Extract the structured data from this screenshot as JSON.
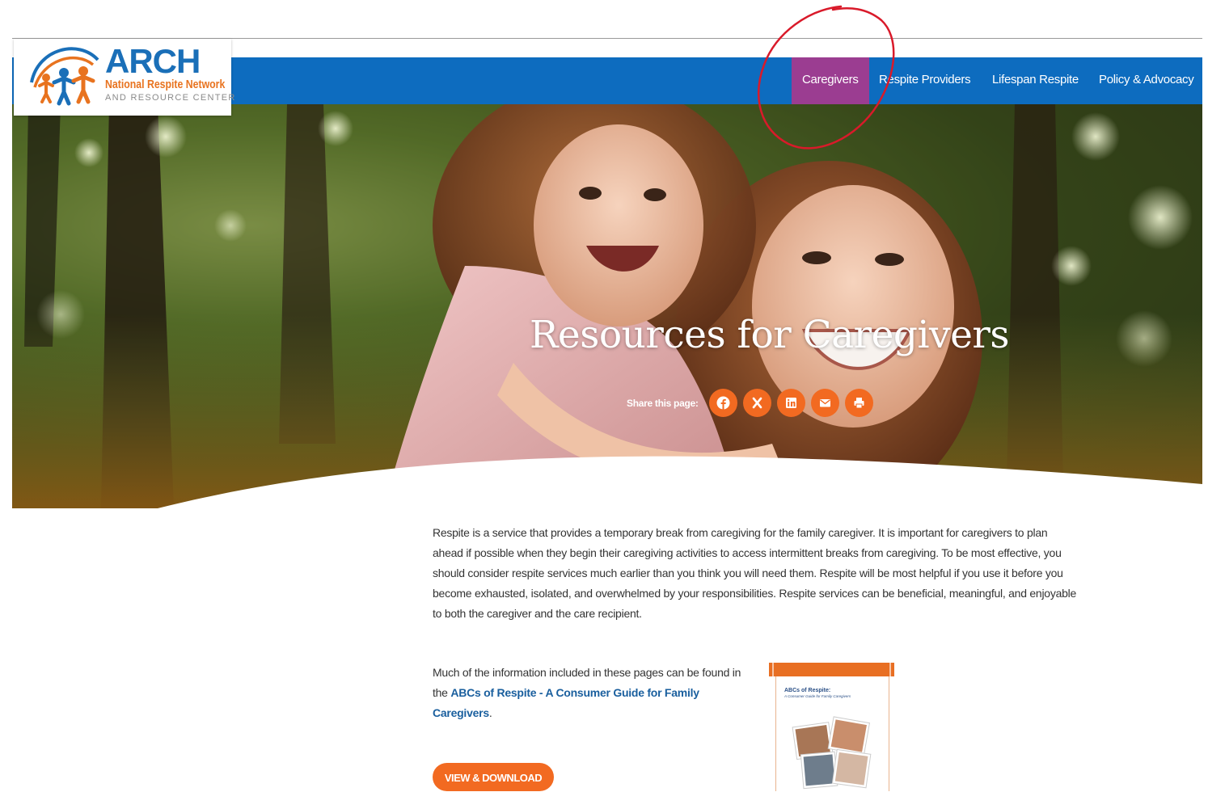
{
  "logo": {
    "title": "ARCH",
    "subtitle": "National Respite Network",
    "tagline": "AND RESOURCE CENTER"
  },
  "nav": {
    "items": [
      {
        "label": "Caregivers",
        "active": true
      },
      {
        "label": "Respite Providers",
        "active": false
      },
      {
        "label": "Lifespan Respite",
        "active": false
      },
      {
        "label": "Policy & Advocacy",
        "active": false
      }
    ]
  },
  "hero": {
    "title": "Resources for Caregivers",
    "share_label": "Share this page:",
    "share_buttons": [
      {
        "icon": "facebook-icon"
      },
      {
        "icon": "x-icon"
      },
      {
        "icon": "linkedin-icon"
      },
      {
        "icon": "email-icon"
      },
      {
        "icon": "print-icon"
      }
    ]
  },
  "content": {
    "intro": "Respite is a service that provides a temporary break from caregiving for the family caregiver. It is important for caregivers to plan ahead if possible when they begin their caregiving activities to access intermittent breaks from caregiving. To be most effective, you should consider respite services much earlier than you think you will need them. Respite will be most helpful if you use it before you become exhausted, isolated, and overwhelmed by your responsibilities. Respite services can be beneficial, meaningful, and enjoyable to both the caregiver and the care recipient.",
    "more_prefix": "Much of the information included in these pages can be found in the ",
    "more_link": "ABCs of Respite - A Consumer Guide for Family Caregivers",
    "more_suffix": ".",
    "download_label": "VIEW & DOWNLOAD"
  },
  "booklet": {
    "title": "ABCs of Respite:",
    "subtitle": "A Consumer Guide for Family Caregivers"
  },
  "colors": {
    "nav_blue": "#0d6cbf",
    "active_purple": "#9b3d91",
    "accent_orange": "#f26a21",
    "link_blue": "#1a5f9e",
    "annotation_red": "#d91a2a"
  }
}
